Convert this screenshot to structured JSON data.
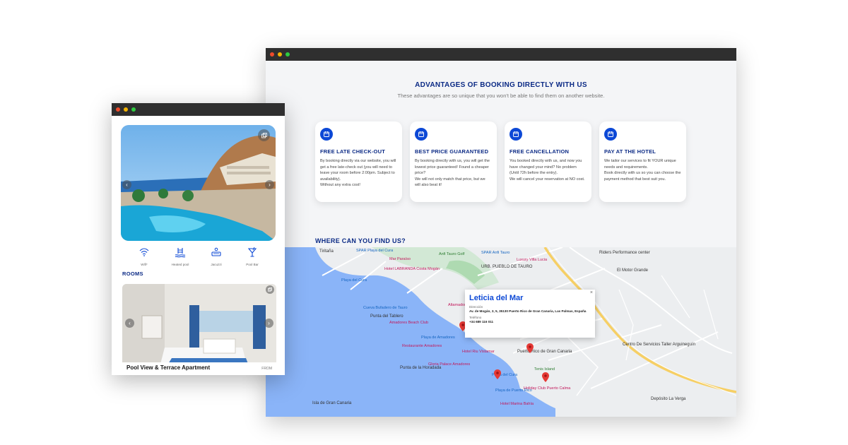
{
  "desktop": {
    "advantages_title": "ADVANTAGES OF BOOKING DIRECTLY WITH US",
    "advantages_subtitle": "These advantages are so unique that you won't be able to find them on another website.",
    "cards": [
      {
        "title": "FREE LATE CHECK-OUT",
        "text": "By booking directly via our website, you will get a free late-check out (you will need to leave your room before 2:00pm. Subject to availability).\nWithout any extra cost!"
      },
      {
        "title": "BEST PRICE GUARANTEED",
        "text": "By booking directly with us, you will get the lowest price guaranteed! Found a cheaper price?\nWe will not only match that price, but we will also beat it!"
      },
      {
        "title": "FREE CANCELLATION",
        "text": "You booked directly with us, and now you have changed your mind? No problem (Until 72h before the entry).\nWe will cancel your reservation at NO cost."
      },
      {
        "title": "PAY AT THE HOTEL",
        "text": "We tailor our services to fit YOUR unique needs and requirements.\nBook directly with us so you can choose the payment method that best suit you."
      }
    ],
    "where_title": "WHERE CAN YOU FIND US?",
    "map": {
      "labels": [
        {
          "text": "Tiritaña",
          "cls": "dark"
        },
        {
          "text": "SPAR Playa del Cura",
          "cls": "blue"
        },
        {
          "text": "Mar Paraíso",
          "cls": "pink"
        },
        {
          "text": "Anfi Tauro Golf",
          "cls": "green"
        },
        {
          "text": "SPAR Anfi Tauro",
          "cls": "blue"
        },
        {
          "text": "Luxury Villa Lucia",
          "cls": "pink"
        },
        {
          "text": "URB. PUEBLO DE TAURO",
          "cls": "dark"
        },
        {
          "text": "Riders Performance center",
          "cls": "dark"
        },
        {
          "text": "El Motor Grande",
          "cls": "dark"
        },
        {
          "text": "Hotel LABRANDA Costa Mogán",
          "cls": "pink"
        },
        {
          "text": "Playa del Cura",
          "cls": "blue"
        },
        {
          "text": "Cueva Bufadero de Tauro",
          "cls": "blue"
        },
        {
          "text": "Punta del Tablero",
          "cls": "dark"
        },
        {
          "text": "Amadores Beach Club",
          "cls": "pink"
        },
        {
          "text": "Restaurante Amadores",
          "cls": "pink"
        },
        {
          "text": "Playa de Amadores",
          "cls": "blue"
        },
        {
          "text": "Hotel Riu Vistamar",
          "cls": "pink"
        },
        {
          "text": "Gloria Palace Amadores",
          "cls": "pink"
        },
        {
          "text": "Punta de la Horadada",
          "cls": "dark"
        },
        {
          "text": "Puerto Rico de Gran Canaria",
          "cls": "dark"
        },
        {
          "text": "Playa del Cura",
          "cls": "blue"
        },
        {
          "text": "Tenis Island",
          "cls": "green"
        },
        {
          "text": "Holiday Club Puerto Calma",
          "cls": "pink"
        },
        {
          "text": "Playa de Puerto Rico",
          "cls": "blue"
        },
        {
          "text": "Hotel Marina Bahía",
          "cls": "pink"
        },
        {
          "text": "Isla de Gran Canaria",
          "cls": "dark"
        },
        {
          "text": "Centro De Servicios Taller Arguineguín",
          "cls": "dark"
        },
        {
          "text": "Depósito La Verga",
          "cls": "dark"
        },
        {
          "text": "Altamadores",
          "cls": "pink"
        }
      ],
      "popup": {
        "close": "×",
        "name": "Leticia del Mar",
        "address_label": "Dirección",
        "address": "Av. de Mogán, 3, 5, 35130 Puerto Rico de Gran Canaria, Las Palmas, España",
        "phone_label": "Teléfono",
        "phone": "+34 689 116 011"
      }
    }
  },
  "mobile": {
    "amenities": [
      {
        "label": "Wifi*",
        "icon": "wifi-icon"
      },
      {
        "label": "Heated pool",
        "icon": "pool-icon"
      },
      {
        "label": "Jacuzzi",
        "icon": "jacuzzi-icon"
      },
      {
        "label": "Pool Bar",
        "icon": "cocktail-icon"
      }
    ],
    "rooms_title": "ROOMS",
    "room": {
      "name": "Pool View & Terrace Apartment",
      "from": "FROM"
    },
    "arrow_prev": "‹",
    "arrow_next": "›"
  },
  "colors": {
    "brand": "#0b2a85",
    "accent": "#0c48d6",
    "pin": "#e53935"
  }
}
